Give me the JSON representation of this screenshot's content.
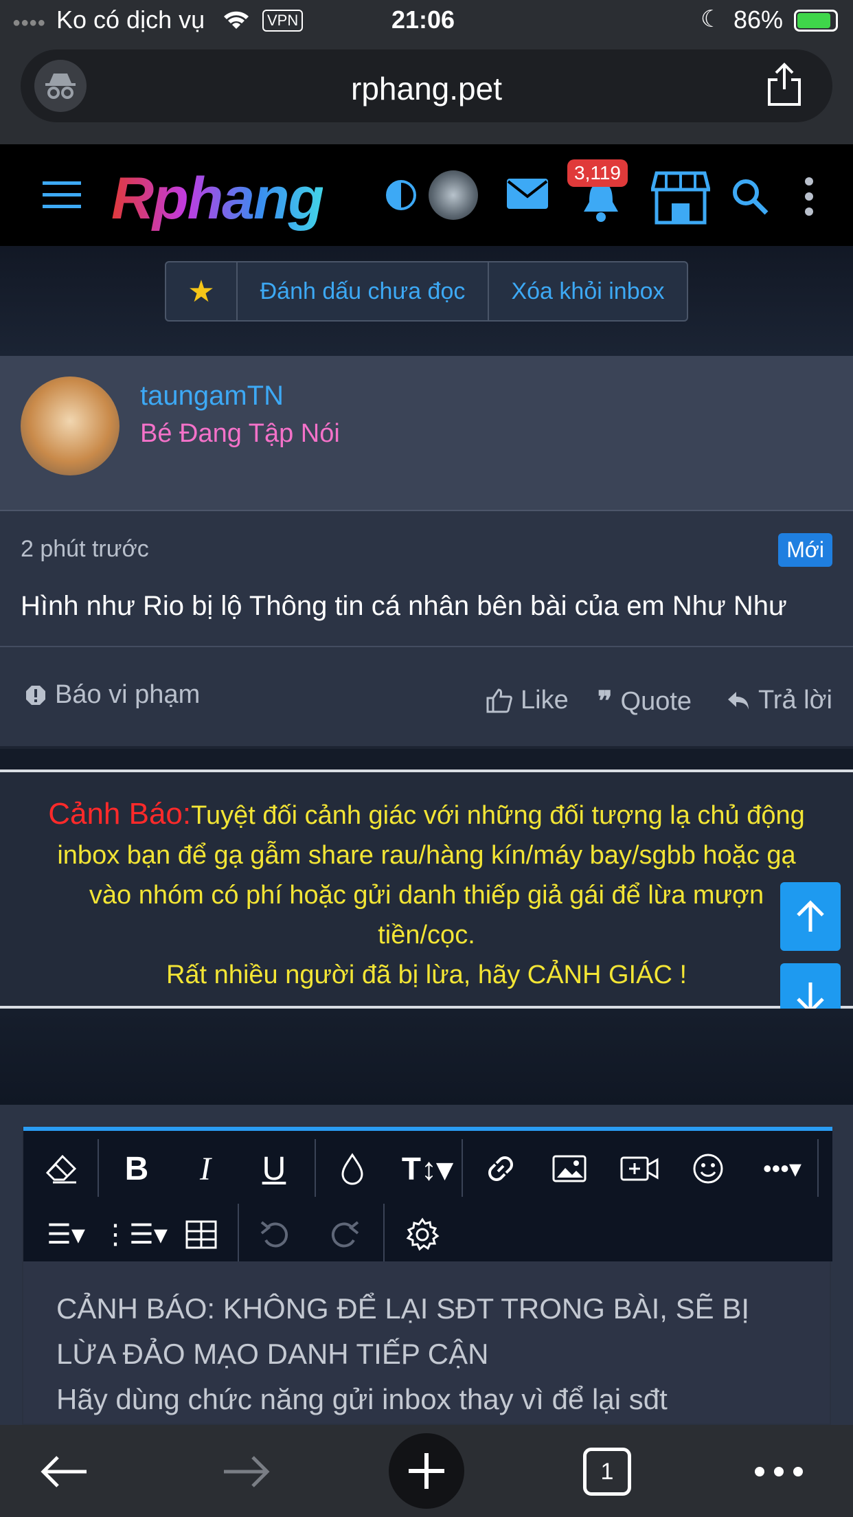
{
  "status_bar": {
    "carrier": "Ko có dịch vụ",
    "vpn": "VPN",
    "time": "21:06",
    "battery": "86%"
  },
  "browser": {
    "url": "rphang.pet"
  },
  "site": {
    "logo": "Rphang",
    "notification_count": "3,119"
  },
  "actions": {
    "mark_unread": "Đánh dấu chưa đọc",
    "remove_inbox": "Xóa khỏi inbox"
  },
  "message": {
    "author": "taungamTN",
    "user_title": "Bé Đang Tập Nói",
    "time": "2 phút trước",
    "badge": "Mới",
    "text": "Hình như Rio bị lộ Thông tin cá nhân bên bài của em Như Như",
    "report": "Báo vi phạm",
    "like": "Like",
    "quote": "Quote",
    "reply": "Trả lời"
  },
  "warning": {
    "label": "Cảnh Báo:",
    "line1": "Tuyệt đối cảnh giác với những đối tượng lạ chủ động",
    "line2": "inbox bạn để gạ gẫm share rau/hàng kín/máy bay/sgbb hoặc gạ",
    "line3": "vào nhóm có phí hoặc gửi danh thiếp giả gái để lừa mượn",
    "line4": "tiền/cọc.",
    "line5": "Rất nhiều người đã bị lừa, hãy CẢNH GIÁC !"
  },
  "editor": {
    "line1": "CẢNH BÁO: KHÔNG ĐỂ LẠI SĐT TRONG BÀI, SẼ BỊ",
    "line2": "LỪA ĐẢO MẠO DANH TIẾP CẬN",
    "line3": "Hãy dùng chức năng gửi inbox thay vì để lại sđt"
  },
  "bottom_bar": {
    "tab_count": "1"
  },
  "colors": {
    "accent": "#3da9f5",
    "warning_text": "#f3e535",
    "warning_label": "#ff2a2a",
    "user_title": "#f472c9"
  }
}
